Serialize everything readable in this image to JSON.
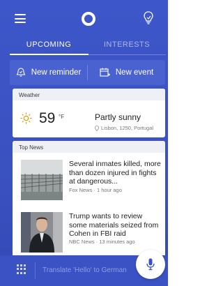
{
  "tabs": [
    {
      "label": "UPCOMING",
      "active": true
    },
    {
      "label": "INTERESTS",
      "active": false
    }
  ],
  "actions": {
    "new_reminder": "New reminder",
    "new_event": "New event"
  },
  "weather": {
    "header": "Weather",
    "temperature": "59",
    "unit": "°F",
    "condition": "Partly sunny",
    "location": "Lisbon, 1250, Portugal"
  },
  "news": {
    "header": "Top News",
    "items": [
      {
        "title": "Several inmates killed, more than dozen injured in fights at dangerous...",
        "source": "Fox News · 1 hour ago"
      },
      {
        "title": "Trump wants to review some materials seized from Cohen in FBI raid",
        "source": "NBC News · 13 minutes ago"
      }
    ]
  },
  "bottom": {
    "ask_prompt": "Translate 'Hello' to German"
  },
  "colors": {
    "accent": "#3d56c9",
    "mic": "#3a51c0"
  }
}
